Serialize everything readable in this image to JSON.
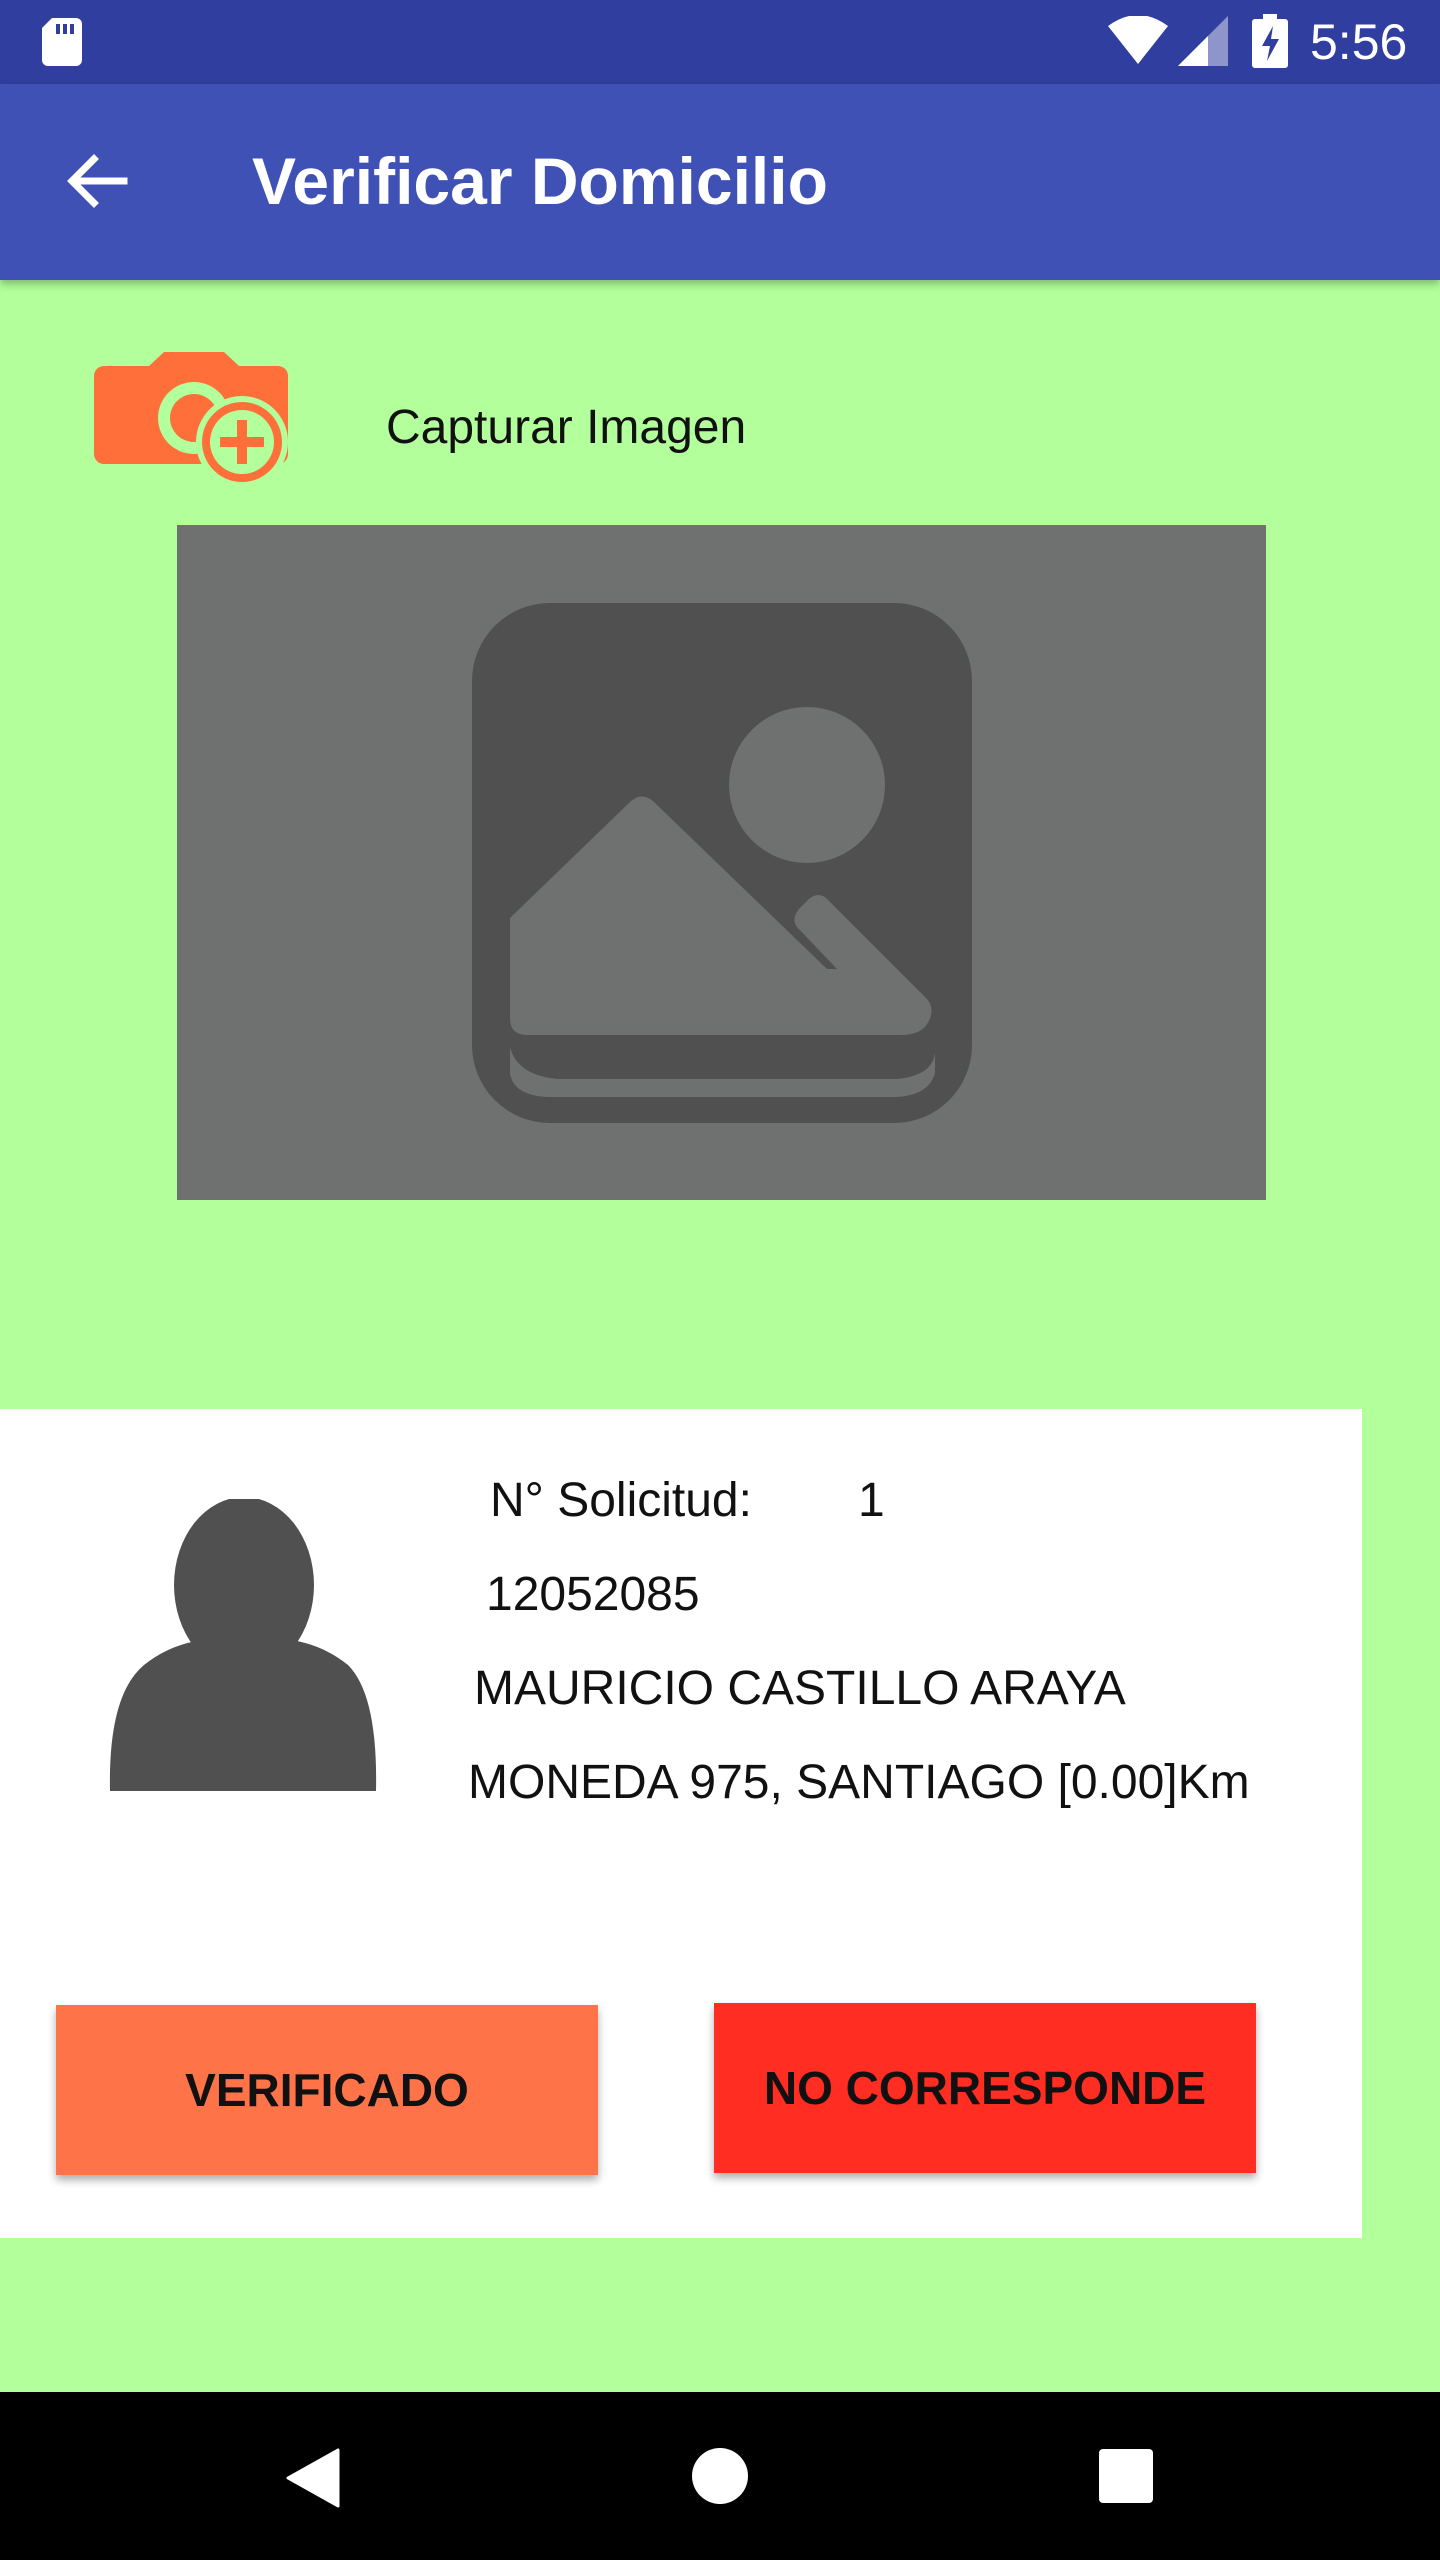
{
  "status_bar": {
    "time": "5:56",
    "icons": [
      "sd-card-icon",
      "wifi-icon",
      "signal-icon",
      "battery-charging-icon"
    ]
  },
  "app_bar": {
    "title": "Verificar Domicilio",
    "back_icon": "arrow-back-icon"
  },
  "capture": {
    "icon": "add-camera-icon",
    "label": "Capturar Imagen"
  },
  "image_placeholder": {
    "icon": "image-placeholder-icon"
  },
  "info": {
    "avatar_icon": "person-icon",
    "solicitud_label": "N° Solicitud:",
    "solicitud_value": "1",
    "rut": "12052085",
    "name": "MAURICIO CASTILLO ARAYA",
    "address": "MONEDA 975, SANTIAGO [0.00]Km"
  },
  "actions": {
    "verified_label": "VERIFICADO",
    "not_match_label": "NO CORRESPONDE"
  },
  "nav_bar": {
    "icons": [
      "nav-back-icon",
      "nav-home-icon",
      "nav-recents-icon"
    ]
  },
  "colors": {
    "status_bar": "#303f9f",
    "app_bar": "#3f51b5",
    "background": "#b2ff9b",
    "accent_orange": "#ff6f3a",
    "verified_button": "#ff7349",
    "not_match_button": "#ff2d22",
    "placeholder_bg": "#6f7170",
    "placeholder_icon": "#505050"
  }
}
